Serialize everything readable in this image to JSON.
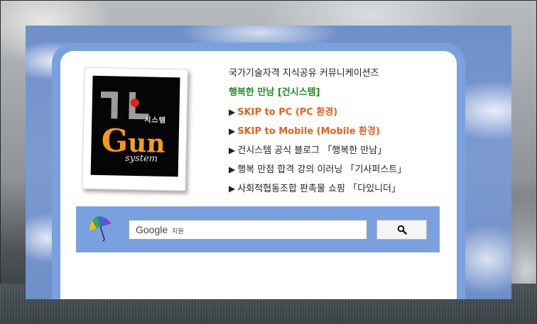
{
  "links": {
    "line1": "국가기술자격 지식공유 커뮤니케이션즈",
    "line2": "행복한 만남 [건시스템]",
    "line3": "SKIP to PC (PC 환경)",
    "line4": "SKIP to Mobile (Mobile 환경)",
    "line5": "건시스템 공식 블로그 「행복한 만남」",
    "line6": "행복 만점 합격 강의 이러닝 「기사퍼스트」",
    "line7": "사회적협동조합 판촉물 쇼핑 「다있니더」",
    "arrow": "▶"
  },
  "logo": {
    "sys_text": "시스템",
    "gun_g": "G",
    "gun_rest": "un",
    "system_text": "system"
  },
  "search": {
    "brand": "Google",
    "brand_sub": "지원",
    "value": "",
    "button_icon": "magnifier-icon"
  },
  "colors": {
    "accent_blue": "#7aa1df",
    "green": "#1e8c1e",
    "orange": "#e8601a",
    "logo_orange": "#f49a12",
    "logo_red_dot": "#e62020"
  }
}
